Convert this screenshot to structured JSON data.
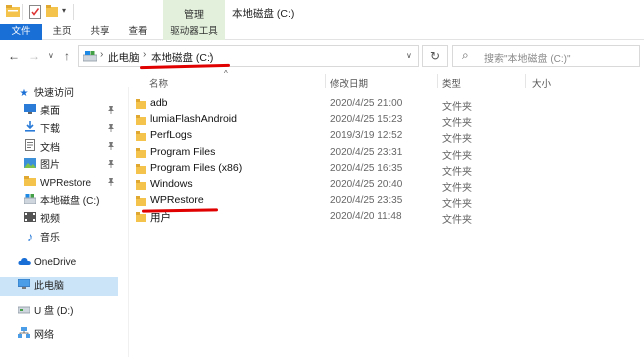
{
  "window": {
    "title": "本地磁盘 (C:)",
    "context_tab": "管理"
  },
  "ribbon": {
    "tabs": [
      "文件",
      "主页",
      "共享",
      "查看",
      "驱动器工具"
    ]
  },
  "nav": {
    "breadcrumb": [
      "此电脑",
      "本地磁盘 (C:)"
    ],
    "search_placeholder": "搜索\"本地磁盘 (C:)\""
  },
  "sidebar": {
    "quick_access": "快速访问",
    "items": [
      "桌面",
      "下载",
      "文档",
      "图片",
      "WPRestore",
      "本地磁盘 (C:)",
      "视频",
      "音乐"
    ],
    "onedrive": "OneDrive",
    "thispc": "此电脑",
    "udisk": "U 盘 (D:)",
    "network": "网络"
  },
  "columns": {
    "name": "名称",
    "modified": "修改日期",
    "type": "类型",
    "size": "大小"
  },
  "files": [
    {
      "name": "adb",
      "date": "2020/4/25 21:00",
      "type": "文件夹"
    },
    {
      "name": "lumiaFlashAndroid",
      "date": "2020/4/25 15:23",
      "type": "文件夹"
    },
    {
      "name": "PerfLogs",
      "date": "2019/3/19 12:52",
      "type": "文件夹"
    },
    {
      "name": "Program Files",
      "date": "2020/4/25 23:31",
      "type": "文件夹"
    },
    {
      "name": "Program Files (x86)",
      "date": "2020/4/25 16:35",
      "type": "文件夹"
    },
    {
      "name": "Windows",
      "date": "2020/4/25 20:40",
      "type": "文件夹"
    },
    {
      "name": "WPRestore",
      "date": "2020/4/25 23:35",
      "type": "文件夹"
    },
    {
      "name": "用户",
      "date": "2020/4/20 11:48",
      "type": "文件夹"
    }
  ],
  "colors": {
    "accent": "#1a6fd6",
    "context_tab": "#e3f1dc",
    "folder": "#f3c34c",
    "annotation": "#e00000",
    "selected": "#cce4f7"
  },
  "icons": {
    "back": "←",
    "forward": "→",
    "dropdown": "∨",
    "up": "↑",
    "refresh": "↻",
    "search": "⌕",
    "chevron": "›",
    "star": "★",
    "pin": "📌",
    "folder": "folder-icon"
  }
}
